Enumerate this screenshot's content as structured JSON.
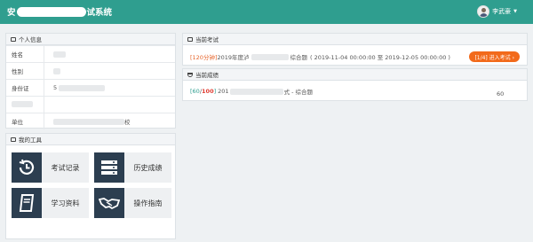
{
  "header": {
    "title_left": "安",
    "title_right": "试系统",
    "user_name": "李武豪"
  },
  "info": {
    "title": "个人信息",
    "rows": [
      {
        "label": "姓名",
        "value": ""
      },
      {
        "label": "性别",
        "value": ""
      },
      {
        "label": "身份证",
        "value": "5"
      },
      {
        "label": "",
        "value": ""
      },
      {
        "label": "单位",
        "value": "校"
      }
    ]
  },
  "tools": {
    "title": "我的工具",
    "items": [
      {
        "label": "考试记录",
        "icon": "history-icon"
      },
      {
        "label": "历史成绩",
        "icon": "server-icon"
      },
      {
        "label": "学习资料",
        "icon": "book-icon"
      },
      {
        "label": "操作指南",
        "icon": "handshake-icon"
      }
    ]
  },
  "current_exam": {
    "title": "当前考试",
    "duration": "[120分钟]",
    "name_prefix": "2019年度泸",
    "name_suffix": "综合题",
    "period": "( 2019-11-04 00:00:00 至 2019-12-05 00:00:00 )",
    "button": "[1/4] 进入考试 ›"
  },
  "current_score": {
    "title": "当前成绩",
    "score": "60",
    "total": "100",
    "name_prefix": "201",
    "name_suffix": "式 - 综合题",
    "points": "60"
  },
  "colors": {
    "header": "#2f9e8f",
    "accent": "#f26a1b",
    "tile_icon_bg": "#2c3e50"
  }
}
